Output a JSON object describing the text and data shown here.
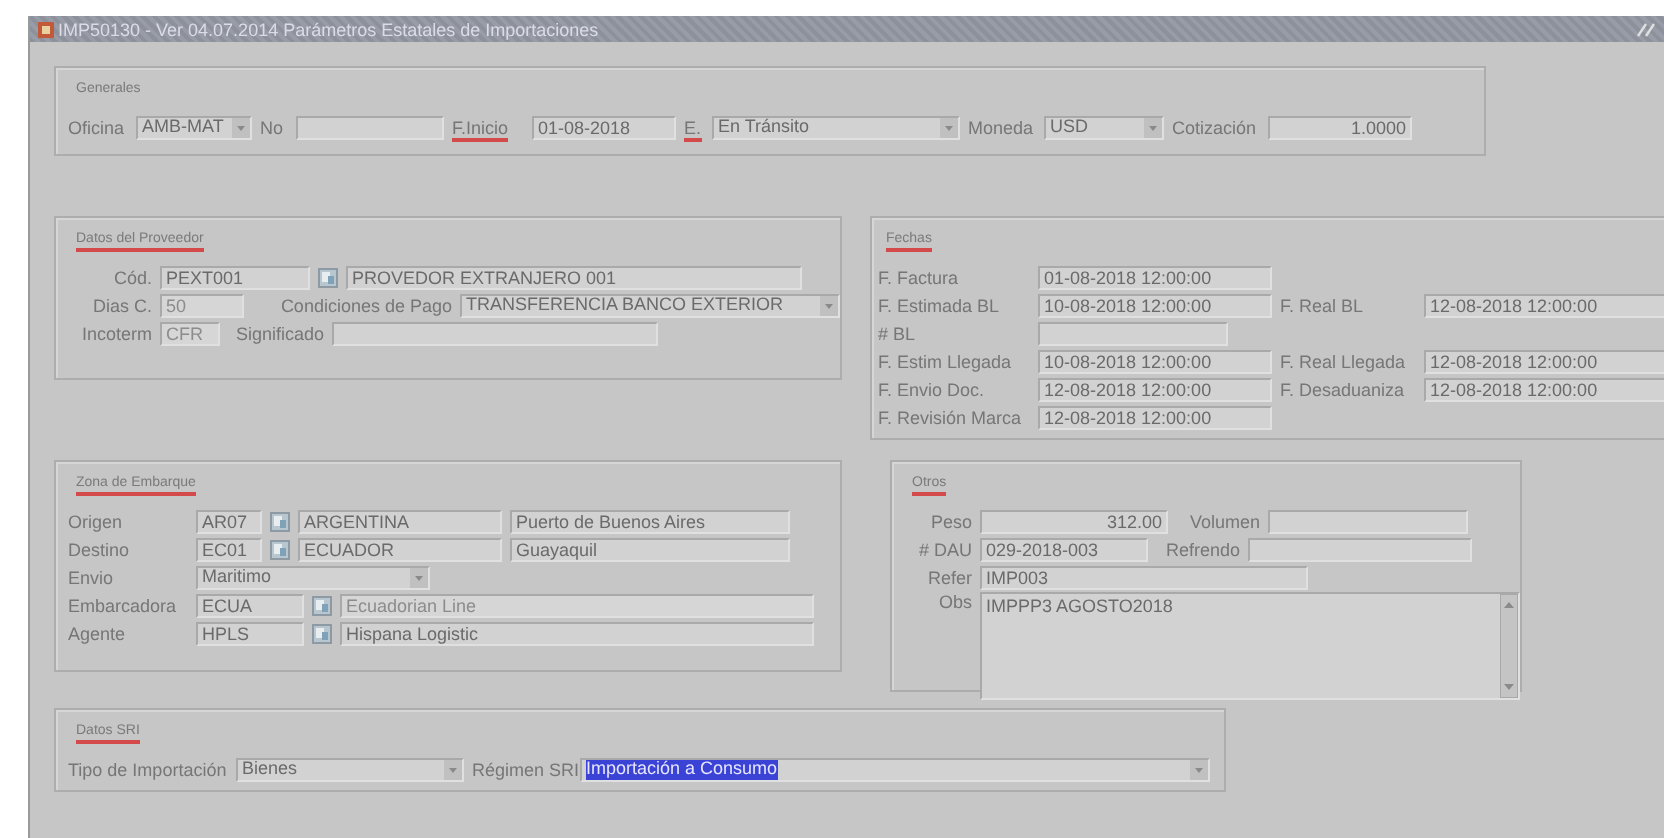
{
  "window": {
    "title": "IMP50130 - Ver 04.07.2014 Parámetros Estatales de Importaciones"
  },
  "sections": [
    {
      "title": "Generales",
      "marked": false,
      "rows": [
        [
          {
            "kind": "label",
            "text": "Oficina",
            "marked": false
          },
          {
            "kind": "combo",
            "value": "AMB-MAT"
          },
          {
            "kind": "label",
            "text": "No",
            "marked": false
          },
          {
            "kind": "text"
          },
          {
            "kind": "label",
            "text": "F.Inicio",
            "marked": true
          },
          {
            "kind": "text",
            "value": "01-08-2018"
          },
          {
            "kind": "label",
            "text": "E.",
            "marked": true
          },
          {
            "kind": "combo",
            "value": "En Tránsito"
          },
          {
            "kind": "label",
            "text": "Moneda",
            "marked": false
          },
          {
            "kind": "combo",
            "value": "USD"
          },
          {
            "kind": "label",
            "text": "Cotización",
            "marked": false
          },
          {
            "kind": "number",
            "value": "1.0000"
          }
        ]
      ]
    },
    {
      "title": "Datos del Proveedor",
      "marked": true,
      "rows": [
        [
          {
            "kind": "label",
            "text": "Cód."
          },
          {
            "kind": "text",
            "value": "PEXT001"
          },
          {
            "kind": "lov"
          },
          {
            "kind": "text",
            "value": "PROVEDOR EXTRANJERO 001"
          }
        ],
        [
          {
            "kind": "label",
            "text": "Dias C."
          },
          {
            "kind": "readonly",
            "value": "50"
          },
          {
            "kind": "label",
            "text": "Condiciones de Pago"
          },
          {
            "kind": "combo",
            "value": "TRANSFERENCIA BANCO EXTERIOR"
          }
        ],
        [
          {
            "kind": "label",
            "text": "Incoterm"
          },
          {
            "kind": "readonly",
            "value": "CFR"
          },
          {
            "kind": "label",
            "text": "Significado"
          },
          {
            "kind": "text"
          }
        ]
      ]
    },
    {
      "title": "Fechas",
      "marked": true,
      "rows": [
        [
          {
            "kind": "label",
            "text": "F. Factura"
          },
          {
            "kind": "text",
            "value": "01-08-2018 12:00:00"
          }
        ],
        [
          {
            "kind": "label",
            "text": "F. Estimada BL"
          },
          {
            "kind": "text",
            "value": "10-08-2018 12:00:00"
          },
          {
            "kind": "label",
            "text": "F. Real BL"
          },
          {
            "kind": "text",
            "value": "12-08-2018 12:00:00"
          }
        ],
        [
          {
            "kind": "label",
            "text": "# BL"
          },
          {
            "kind": "text"
          }
        ],
        [
          {
            "kind": "label",
            "text": "F. Estim Llegada"
          },
          {
            "kind": "text",
            "value": "10-08-2018 12:00:00"
          },
          {
            "kind": "label",
            "text": "F. Real Llegada"
          },
          {
            "kind": "text",
            "value": "12-08-2018 12:00:00"
          }
        ],
        [
          {
            "kind": "label",
            "text": "F. Envio Doc."
          },
          {
            "kind": "text",
            "value": "12-08-2018 12:00:00"
          },
          {
            "kind": "label",
            "text": "F. Desaduaniza"
          },
          {
            "kind": "text",
            "value": "12-08-2018 12:00:00"
          }
        ],
        [
          {
            "kind": "label",
            "text": "F. Revisión Marca"
          },
          {
            "kind": "text",
            "value": "12-08-2018 12:00:00"
          }
        ]
      ]
    },
    {
      "title": "Zona de Embarque",
      "marked": true,
      "rows": [
        [
          {
            "kind": "label",
            "text": "Origen"
          },
          {
            "kind": "text",
            "value": "AR07"
          },
          {
            "kind": "lov"
          },
          {
            "kind": "text",
            "value": "ARGENTINA"
          },
          {
            "kind": "text",
            "value": "Puerto de Buenos Aires"
          }
        ],
        [
          {
            "kind": "label",
            "text": "Destino"
          },
          {
            "kind": "text",
            "value": "EC01"
          },
          {
            "kind": "lov"
          },
          {
            "kind": "text",
            "value": "ECUADOR"
          },
          {
            "kind": "text",
            "value": "Guayaquil"
          }
        ],
        [
          {
            "kind": "label",
            "text": "Envio"
          },
          {
            "kind": "combo",
            "value": "Maritimo"
          }
        ],
        [
          {
            "kind": "label",
            "text": "Embarcadora"
          },
          {
            "kind": "text",
            "value": "ECUA"
          },
          {
            "kind": "lov"
          },
          {
            "kind": "readonly",
            "value": "Ecuadorian Line"
          }
        ],
        [
          {
            "kind": "label",
            "text": "Agente"
          },
          {
            "kind": "text",
            "value": "HPLS"
          },
          {
            "kind": "lov"
          },
          {
            "kind": "text",
            "value": "Hispana Logistic"
          }
        ]
      ]
    },
    {
      "title": "Otros",
      "marked": true,
      "rows": [
        [
          {
            "kind": "label",
            "text": "Peso"
          },
          {
            "kind": "number",
            "value": "312.00"
          },
          {
            "kind": "label",
            "text": "Volumen"
          },
          {
            "kind": "text"
          }
        ],
        [
          {
            "kind": "label",
            "text": "# DAU"
          },
          {
            "kind": "text",
            "value": "029-2018-003"
          },
          {
            "kind": "label",
            "text": "Refrendo"
          },
          {
            "kind": "text"
          }
        ],
        [
          {
            "kind": "label",
            "text": "Refer"
          },
          {
            "kind": "text",
            "value": "IMP003"
          }
        ],
        [
          {
            "kind": "label",
            "text": "Obs"
          },
          {
            "kind": "area",
            "value": "IMPPP3 AGOSTO2018"
          }
        ]
      ]
    },
    {
      "title": "Datos SRI",
      "marked": true,
      "rows": [
        [
          {
            "kind": "label",
            "text": "Tipo de  Importación"
          },
          {
            "kind": "combo",
            "value": "Bienes"
          },
          {
            "kind": "label",
            "text": "Régimen SRI"
          },
          {
            "kind": "combo-highlight",
            "value": "Importación a Consumo"
          }
        ]
      ]
    }
  ]
}
